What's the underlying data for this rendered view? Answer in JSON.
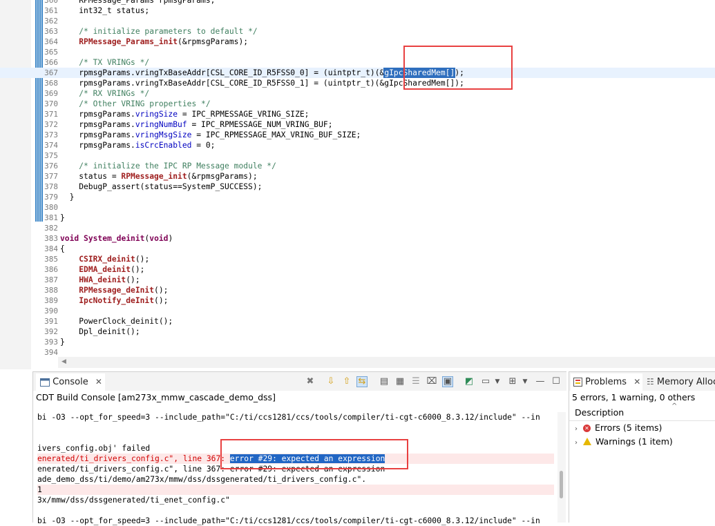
{
  "editor": {
    "lines": [
      {
        "num": "360",
        "segments": [
          {
            "t": "    RPMessage_Params rpmsgParams;",
            "c": ""
          }
        ]
      },
      {
        "num": "361",
        "segments": [
          {
            "t": "    int32_t status;",
            "c": ""
          }
        ]
      },
      {
        "num": "362",
        "segments": []
      },
      {
        "num": "363",
        "segments": [
          {
            "t": "    ",
            "c": ""
          },
          {
            "t": "/* initialize parameters to default */",
            "c": "comment"
          }
        ]
      },
      {
        "num": "364",
        "segments": [
          {
            "t": "    ",
            "c": ""
          },
          {
            "t": "RPMessage_Params_init",
            "c": "fn"
          },
          {
            "t": "(&rpmsgParams);",
            "c": ""
          }
        ]
      },
      {
        "num": "365",
        "segments": []
      },
      {
        "num": "366",
        "segments": [
          {
            "t": "    ",
            "c": ""
          },
          {
            "t": "/* TX VRINGs */",
            "c": "comment"
          }
        ]
      },
      {
        "num": "367",
        "current": true,
        "segments": [
          {
            "t": "    rpmsgParams.",
            "c": ""
          },
          {
            "t": "vringTxBaseAddr",
            "c": ""
          },
          {
            "t": "[CSL_CORE_ID_R5FSS0_0] = (uintptr_t)(&",
            "c": ""
          },
          {
            "t": "gIpcSharedMem[]",
            "c": "selected"
          },
          {
            "t": ");",
            "c": ""
          }
        ]
      },
      {
        "num": "368",
        "segments": [
          {
            "t": "    rpmsgParams.vringTxBaseAddr[CSL_CORE_ID_R5FSS0_1] = (uintptr_t)(&gIpcSharedMem[]);",
            "c": ""
          }
        ]
      },
      {
        "num": "369",
        "segments": [
          {
            "t": "    ",
            "c": ""
          },
          {
            "t": "/* RX VRINGs */",
            "c": "comment"
          }
        ]
      },
      {
        "num": "370",
        "segments": [
          {
            "t": "    ",
            "c": ""
          },
          {
            "t": "/* Other VRING properties */",
            "c": "comment"
          }
        ]
      },
      {
        "num": "371",
        "segments": [
          {
            "t": "    rpmsgParams.",
            "c": ""
          },
          {
            "t": "vringSize",
            "c": "fld"
          },
          {
            "t": " = IPC_RPMESSAGE_VRING_SIZE;",
            "c": ""
          }
        ]
      },
      {
        "num": "372",
        "segments": [
          {
            "t": "    rpmsgParams.",
            "c": ""
          },
          {
            "t": "vringNumBuf",
            "c": "fld"
          },
          {
            "t": " = IPC_RPMESSAGE_NUM_VRING_BUF;",
            "c": ""
          }
        ]
      },
      {
        "num": "373",
        "segments": [
          {
            "t": "    rpmsgParams.",
            "c": ""
          },
          {
            "t": "vringMsgSize",
            "c": "fld"
          },
          {
            "t": " = IPC_RPMESSAGE_MAX_VRING_BUF_SIZE;",
            "c": ""
          }
        ]
      },
      {
        "num": "374",
        "segments": [
          {
            "t": "    rpmsgParams.",
            "c": ""
          },
          {
            "t": "isCrcEnabled",
            "c": "fld"
          },
          {
            "t": " = 0;",
            "c": ""
          }
        ]
      },
      {
        "num": "375",
        "segments": []
      },
      {
        "num": "376",
        "segments": [
          {
            "t": "    ",
            "c": ""
          },
          {
            "t": "/* initialize the IPC RP Message module */",
            "c": "comment"
          }
        ]
      },
      {
        "num": "377",
        "segments": [
          {
            "t": "    status = ",
            "c": ""
          },
          {
            "t": "RPMessage_init",
            "c": "fn"
          },
          {
            "t": "(&rpmsgParams);",
            "c": ""
          }
        ]
      },
      {
        "num": "378",
        "segments": [
          {
            "t": "    DebugP_assert(status==SystemP_SUCCESS);",
            "c": ""
          }
        ]
      },
      {
        "num": "379",
        "segments": [
          {
            "t": "  }",
            "c": ""
          }
        ]
      },
      {
        "num": "380",
        "segments": []
      },
      {
        "num": "381",
        "segments": [
          {
            "t": "}",
            "c": ""
          }
        ]
      },
      {
        "num": "382",
        "segments": []
      },
      {
        "num": "383",
        "segments": [
          {
            "t": "void",
            "c": "kw"
          },
          {
            "t": " ",
            "c": ""
          },
          {
            "t": "System_deinit",
            "c": "kw"
          },
          {
            "t": "(",
            "c": ""
          },
          {
            "t": "void",
            "c": "kw"
          },
          {
            "t": ")",
            "c": ""
          }
        ]
      },
      {
        "num": "384",
        "segments": [
          {
            "t": "{",
            "c": ""
          }
        ]
      },
      {
        "num": "385",
        "segments": [
          {
            "t": "    ",
            "c": ""
          },
          {
            "t": "CSIRX_deinit",
            "c": "fn"
          },
          {
            "t": "();",
            "c": ""
          }
        ]
      },
      {
        "num": "386",
        "segments": [
          {
            "t": "    ",
            "c": ""
          },
          {
            "t": "EDMA_deinit",
            "c": "fn"
          },
          {
            "t": "();",
            "c": ""
          }
        ]
      },
      {
        "num": "387",
        "segments": [
          {
            "t": "    ",
            "c": ""
          },
          {
            "t": "HWA_deinit",
            "c": "fn"
          },
          {
            "t": "();",
            "c": ""
          }
        ]
      },
      {
        "num": "388",
        "segments": [
          {
            "t": "    ",
            "c": ""
          },
          {
            "t": "RPMessage_deInit",
            "c": "fn"
          },
          {
            "t": "();",
            "c": ""
          }
        ]
      },
      {
        "num": "389",
        "segments": [
          {
            "t": "    ",
            "c": ""
          },
          {
            "t": "IpcNotify_deInit",
            "c": "fn"
          },
          {
            "t": "();",
            "c": ""
          }
        ]
      },
      {
        "num": "390",
        "segments": []
      },
      {
        "num": "391",
        "segments": [
          {
            "t": "    PowerClock_deinit();",
            "c": ""
          }
        ]
      },
      {
        "num": "392",
        "segments": [
          {
            "t": "    Dpl_deinit();",
            "c": ""
          }
        ]
      },
      {
        "num": "393",
        "segments": [
          {
            "t": "}",
            "c": ""
          }
        ]
      },
      {
        "num": "394",
        "segments": []
      }
    ]
  },
  "console": {
    "tab_label": "Console",
    "title": "CDT Build Console [am273x_mmw_cascade_demo_dss]",
    "lines": [
      {
        "text": "bi -O3 --opt_for_speed=3 --include_path=\"C:/ti/ccs1281/ccs/tools/compiler/ti-cgt-c6000_8.3.12/include\" --in",
        "kind": ""
      },
      {
        "text": "",
        "kind": ""
      },
      {
        "text": "",
        "kind": ""
      },
      {
        "text": "ivers_config.obj' failed",
        "kind": ""
      },
      {
        "text": "enerated/ti_drivers_config.c\", line 367: ",
        "hl": "error #29: expected an expression",
        "kind": "err"
      },
      {
        "text": "enerated/ti_drivers_config.c\", line 367: error #29: expected an expression",
        "kind": ""
      },
      {
        "text": "ade_demo_dss/ti/demo/am273x/mmw/dss/dssgenerated/ti_drivers_config.c\".",
        "kind": ""
      },
      {
        "text": "1",
        "kind": "err"
      },
      {
        "text": "3x/mmw/dss/dssgenerated/ti_enet_config.c\"",
        "kind": ""
      },
      {
        "text": "",
        "kind": ""
      },
      {
        "text": "bi -O3 --opt_for_speed=3 --include_path=\"C:/ti/ccs1281/ccs/tools/compiler/ti-cgt-c6000_8.3.12/include\" --in",
        "kind": ""
      }
    ]
  },
  "problems": {
    "tab_label": "Problems",
    "memory_tab_label": "Memory Alloc",
    "summary": "5 errors, 1 warning, 0 others",
    "column": "Description",
    "rows": [
      {
        "label": "Errors (5 items)",
        "icon": "error-icon"
      },
      {
        "label": "Warnings (1 item)",
        "icon": "warning-icon"
      }
    ]
  },
  "colors": {
    "annotation_box": "#e84040",
    "selection": "#2f6fbe",
    "error_text": "#d00000"
  }
}
